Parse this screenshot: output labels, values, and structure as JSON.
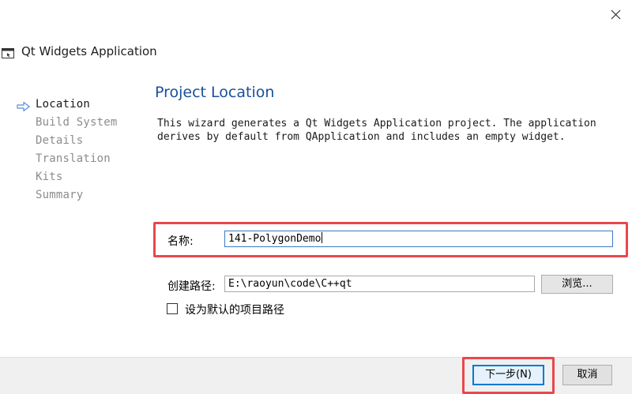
{
  "window": {
    "title": "Qt Widgets Application",
    "close_icon": "close-icon"
  },
  "sidebar": {
    "current_indicator_icon": "arrow-right-icon",
    "steps": [
      {
        "label": "Location",
        "active": true
      },
      {
        "label": "Build System",
        "active": false
      },
      {
        "label": "Details",
        "active": false
      },
      {
        "label": "Translation",
        "active": false
      },
      {
        "label": "Kits",
        "active": false
      },
      {
        "label": "Summary",
        "active": false
      }
    ]
  },
  "main": {
    "title": "Project Location",
    "description": "This wizard generates a Qt Widgets Application project. The application\nderives by default from QApplication and includes an empty widget.",
    "name_label": "名称:",
    "name_value": "141-PolygonDemo",
    "path_label": "创建路径:",
    "path_value": "E:\\raoyun\\code\\C++qt",
    "browse_label": "浏览...",
    "default_path_label": "设为默认的项目路径",
    "default_path_checked": false
  },
  "footer": {
    "next_label": "下一步(N)",
    "cancel_label": "取消"
  },
  "colors": {
    "title_blue": "#1a4f9c",
    "highlight_red": "#e8474d",
    "focus_blue": "#0078d7"
  }
}
